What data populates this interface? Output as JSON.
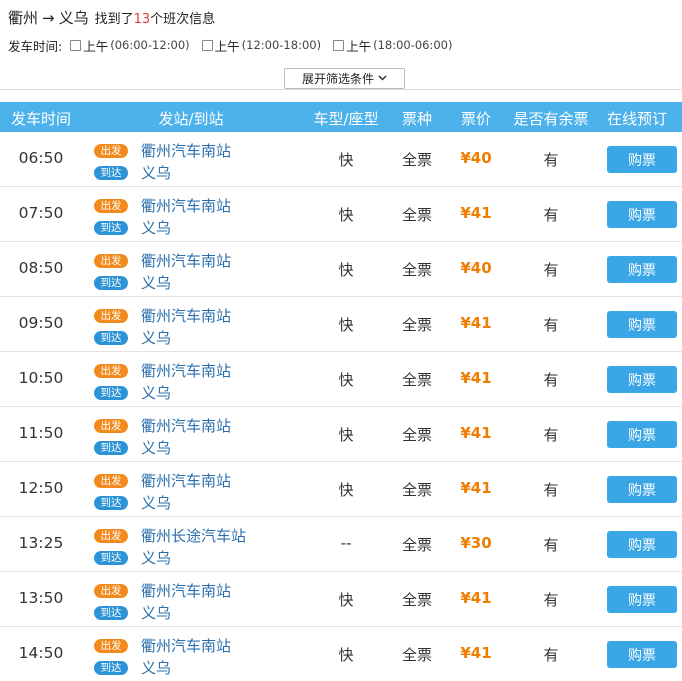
{
  "header": {
    "from": "衢州",
    "arrow": "→",
    "to": "义乌",
    "found_prefix": "找到了",
    "found_count": "13",
    "found_suffix": "个班次信息"
  },
  "filter": {
    "label": "发车时间:",
    "options": [
      {
        "label": "上午",
        "time": "(06:00-12:00)"
      },
      {
        "label": "上午",
        "time": "(12:00-18:00)"
      },
      {
        "label": "上午",
        "time": "(18:00-06:00)"
      }
    ],
    "expand_label": "展开筛选条件"
  },
  "table": {
    "columns": [
      "发车时间",
      "发站/到站",
      "车型/座型",
      "票种",
      "票价",
      "是否有余票",
      "在线预订"
    ],
    "badge_dep": "出发",
    "badge_arr": "到达",
    "buy_label": "购票",
    "rows": [
      {
        "time": "06:50",
        "from": "衢州汽车南站",
        "to": "义乌",
        "type": "快",
        "ticket": "全票",
        "price": "¥40",
        "remain": "有"
      },
      {
        "time": "07:50",
        "from": "衢州汽车南站",
        "to": "义乌",
        "type": "快",
        "ticket": "全票",
        "price": "¥41",
        "remain": "有"
      },
      {
        "time": "08:50",
        "from": "衢州汽车南站",
        "to": "义乌",
        "type": "快",
        "ticket": "全票",
        "price": "¥40",
        "remain": "有"
      },
      {
        "time": "09:50",
        "from": "衢州汽车南站",
        "to": "义乌",
        "type": "快",
        "ticket": "全票",
        "price": "¥41",
        "remain": "有"
      },
      {
        "time": "10:50",
        "from": "衢州汽车南站",
        "to": "义乌",
        "type": "快",
        "ticket": "全票",
        "price": "¥41",
        "remain": "有"
      },
      {
        "time": "11:50",
        "from": "衢州汽车南站",
        "to": "义乌",
        "type": "快",
        "ticket": "全票",
        "price": "¥41",
        "remain": "有"
      },
      {
        "time": "12:50",
        "from": "衢州汽车南站",
        "to": "义乌",
        "type": "快",
        "ticket": "全票",
        "price": "¥41",
        "remain": "有"
      },
      {
        "time": "13:25",
        "from": "衢州长途汽车站",
        "to": "义乌",
        "type": "--",
        "ticket": "全票",
        "price": "¥30",
        "remain": "有"
      },
      {
        "time": "13:50",
        "from": "衢州汽车南站",
        "to": "义乌",
        "type": "快",
        "ticket": "全票",
        "price": "¥41",
        "remain": "有"
      },
      {
        "time": "14:50",
        "from": "衢州汽车南站",
        "to": "义乌",
        "type": "快",
        "ticket": "全票",
        "price": "¥41",
        "remain": "有"
      }
    ]
  }
}
